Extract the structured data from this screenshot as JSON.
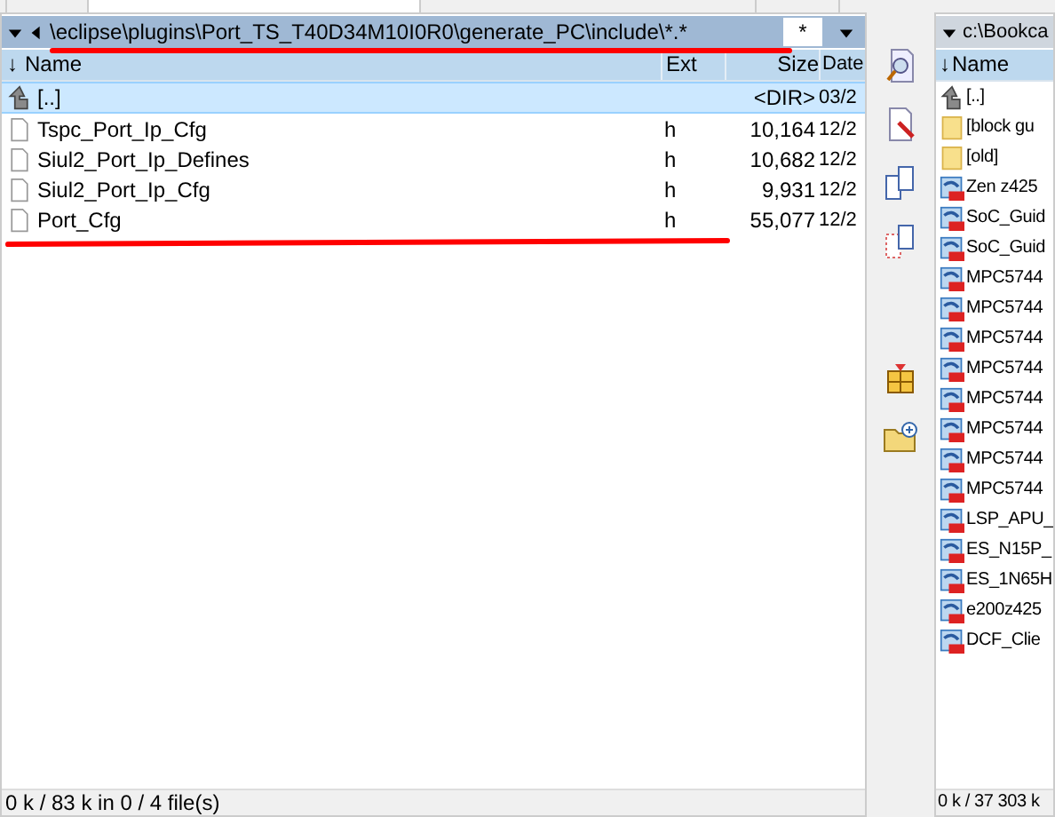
{
  "left_panel": {
    "path": "\\eclipse\\plugins\\Port_TS_T40D34M10I0R0\\generate_PC\\include\\*.*",
    "filter": "*",
    "sort_arrow": "↓",
    "columns": [
      "Name",
      "Ext",
      "Size",
      "Date"
    ],
    "rows": [
      {
        "kind": "parent",
        "name": "[..]",
        "ext": "",
        "size": "<DIR>",
        "date": "03/2",
        "selected": true
      },
      {
        "kind": "file",
        "name": "Tspc_Port_Ip_Cfg",
        "ext": "h",
        "size": "10,164",
        "date": "12/2",
        "selected": false
      },
      {
        "kind": "file",
        "name": "Siul2_Port_Ip_Defines",
        "ext": "h",
        "size": "10,682",
        "date": "12/2",
        "selected": false
      },
      {
        "kind": "file",
        "name": "Siul2_Port_Ip_Cfg",
        "ext": "h",
        "size": "9,931",
        "date": "12/2",
        "selected": false
      },
      {
        "kind": "file",
        "name": "Port_Cfg",
        "ext": "h",
        "size": "55,077",
        "date": "12/2",
        "selected": false
      }
    ],
    "status": "0 k / 83 k in 0 / 4 file(s)"
  },
  "toolbar": [
    {
      "kind": "view"
    },
    {
      "kind": "edit"
    },
    {
      "kind": "copy"
    },
    {
      "kind": "move"
    },
    {
      "kind": "pack"
    },
    {
      "kind": "newfolder"
    }
  ],
  "right_panel": {
    "path": "c:\\Bookca",
    "sort_arrow": "↓",
    "columns": [
      "Name"
    ],
    "rows": [
      {
        "kind": "parent",
        "name": "[..]"
      },
      {
        "kind": "folder",
        "name": "[block gu"
      },
      {
        "kind": "folder",
        "name": "[old]"
      },
      {
        "kind": "pdf",
        "name": "Zen z425"
      },
      {
        "kind": "pdf",
        "name": "SoC_Guid"
      },
      {
        "kind": "pdf",
        "name": "SoC_Guid"
      },
      {
        "kind": "pdf",
        "name": "MPC5744"
      },
      {
        "kind": "pdf",
        "name": "MPC5744"
      },
      {
        "kind": "pdf",
        "name": "MPC5744"
      },
      {
        "kind": "pdf",
        "name": "MPC5744"
      },
      {
        "kind": "pdf",
        "name": "MPC5744"
      },
      {
        "kind": "pdf",
        "name": "MPC5744"
      },
      {
        "kind": "pdf",
        "name": "MPC5744"
      },
      {
        "kind": "pdf",
        "name": "MPC5744"
      },
      {
        "kind": "pdf",
        "name": "LSP_APU_"
      },
      {
        "kind": "pdf",
        "name": "ES_N15P_"
      },
      {
        "kind": "pdf",
        "name": "ES_1N65H"
      },
      {
        "kind": "pdf",
        "name": "e200z425"
      },
      {
        "kind": "pdf",
        "name": "DCF_Clie"
      }
    ],
    "status": "0 k / 37 303 k"
  },
  "markup": {
    "path_underlined": true,
    "list_underlined": true
  }
}
